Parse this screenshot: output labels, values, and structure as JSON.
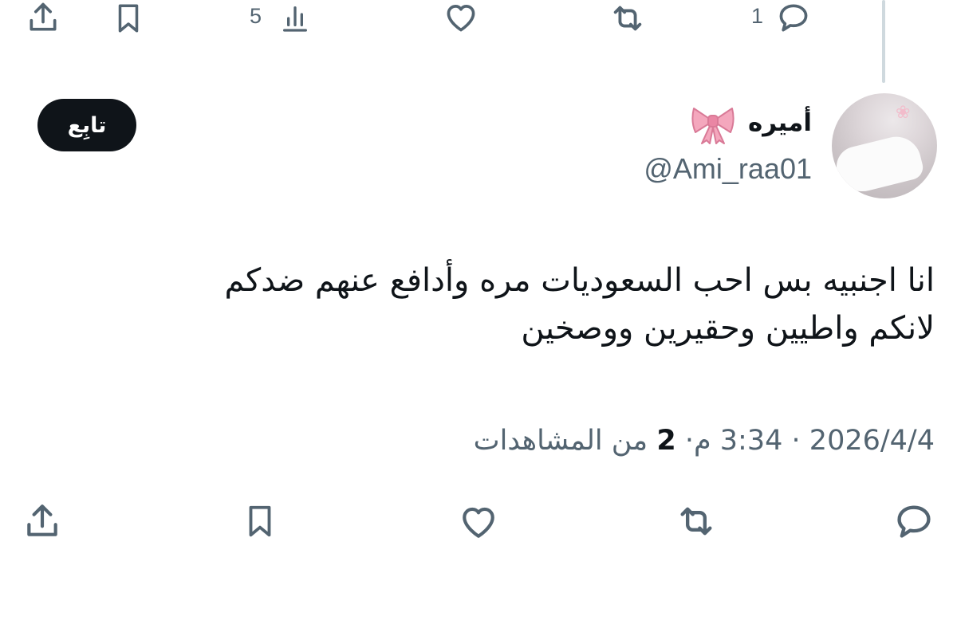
{
  "top_actions": {
    "reply_count": "1",
    "views_count": "5"
  },
  "tweet": {
    "display_name": "أميره",
    "name_emoji": "ribbon-bow",
    "handle": "@Ami_raa01",
    "follow_label": "تابِع",
    "text": "انا اجنبيه بس احب السعوديات مره وأدافع عنهم ضدكم\nلانكم واطيين وحقيرين ووصخين",
    "date": "2026/4/4",
    "time": "3:34",
    "time_suffix": "م",
    "separator": "·",
    "views_count": "2",
    "views_label": "من المشاهدات"
  },
  "colors": {
    "text_primary": "#0f1419",
    "text_secondary": "#536471",
    "thread_line": "#cfd9de",
    "follow_bg": "#0f1419",
    "bow_pink": "#f4a7bd"
  },
  "icons": [
    "share-icon",
    "bookmark-icon",
    "analytics-icon",
    "like-icon",
    "retweet-icon",
    "reply-icon",
    "bow-emoji"
  ]
}
